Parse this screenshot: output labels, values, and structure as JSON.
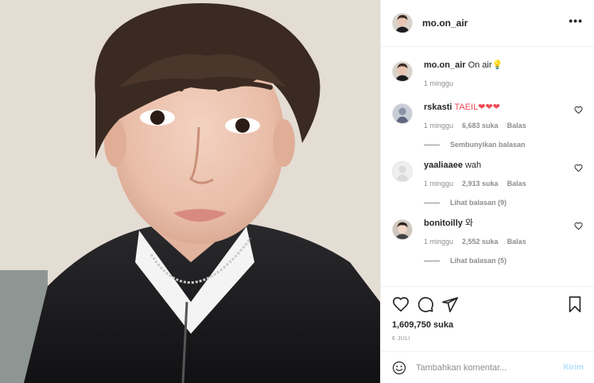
{
  "post": {
    "username": "mo.on_air",
    "photo_alt": "Selfie photo"
  },
  "caption": {
    "username": "mo.on_air",
    "text": "On air💡",
    "time": "1 minggu"
  },
  "comments": [
    {
      "username": "rskasti",
      "text": "TAEIL❤❤❤",
      "time": "1 minggu",
      "likes": "6,683 suka",
      "reply_label": "Balas",
      "toggle_label": "Sembunyikan balasan"
    },
    {
      "username": "yaaliaaee",
      "text": "wah",
      "time": "1 minggu",
      "likes": "2,913 suka",
      "reply_label": "Balas",
      "toggle_label": "Lihat balasan (9)"
    },
    {
      "username": "bonitoilly",
      "text": "와",
      "time": "1 minggu",
      "likes": "2,552 suka",
      "reply_label": "Balas",
      "toggle_label": "Lihat balasan (5)"
    }
  ],
  "actions": {
    "likes": "1,609,750 suka",
    "date": "6 JULI"
  },
  "comment_box": {
    "placeholder": "Tambahkan komentar...",
    "post_label": "Kirim"
  },
  "icons": {
    "more": "more-options-icon",
    "like": "heart-icon",
    "comment": "comment-icon",
    "share": "share-icon",
    "save": "bookmark-icon",
    "emoji": "emoji-icon"
  },
  "colors": {
    "text": "#262626",
    "muted": "#8e8e8e",
    "border": "#efefef",
    "heart_red": "#ed4956",
    "post_button_disabled": "#b2dffc"
  }
}
